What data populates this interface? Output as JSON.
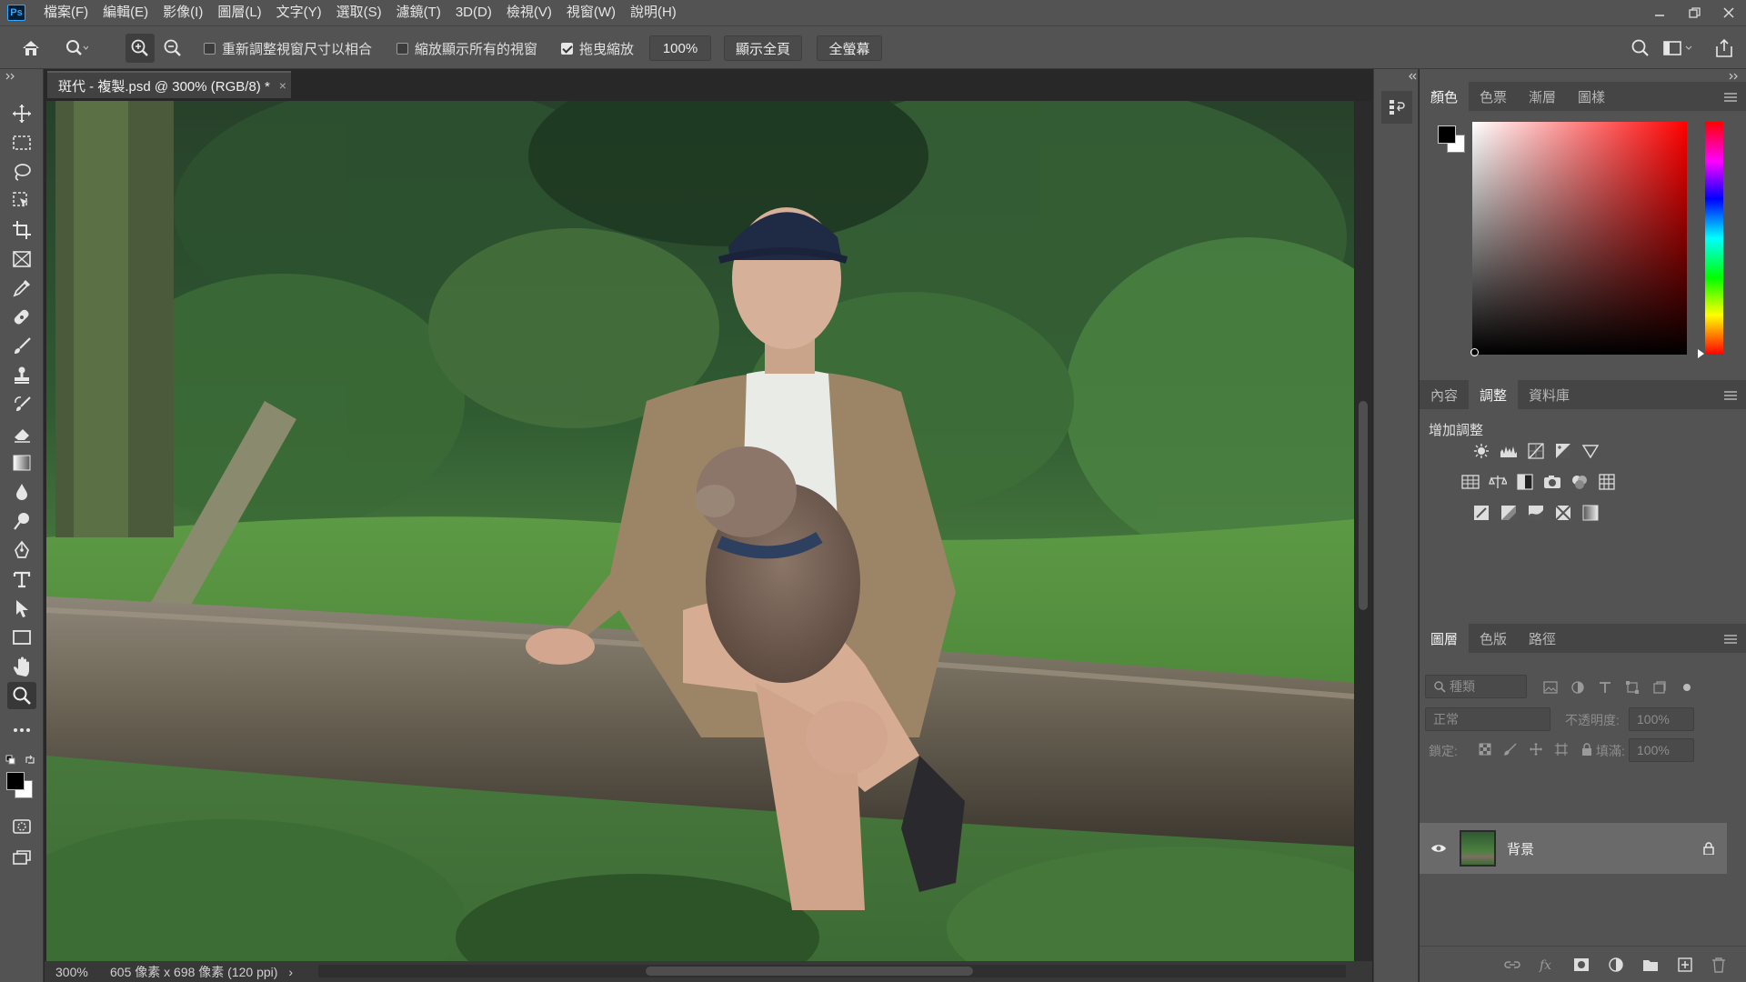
{
  "menubar": {
    "logo": "Ps",
    "items": [
      "檔案(F)",
      "編輯(E)",
      "影像(I)",
      "圖層(L)",
      "文字(Y)",
      "選取(S)",
      "濾鏡(T)",
      "3D(D)",
      "檢視(V)",
      "視窗(W)",
      "說明(H)"
    ]
  },
  "options": {
    "resize_windows_label": "重新調整視窗尺寸以相合",
    "zoom_all_windows_label": "縮放顯示所有的視窗",
    "scrubby_zoom_label": "拖曳縮放",
    "zoom_value": "100%",
    "fit_screen_label": "顯示全頁",
    "fill_screen_label": "全螢幕"
  },
  "document": {
    "tab_title": "斑代 - 複製.psd @ 300% (RGB/8) *",
    "tab_close": "×",
    "zoom": "300%",
    "info": "605 像素 x 698 像素 (120 ppi)",
    "status_arrow": "›"
  },
  "panels": {
    "color_tabs": [
      "顏色",
      "色票",
      "漸層",
      "圖樣"
    ],
    "props_tabs": [
      "內容",
      "調整",
      "資料庫"
    ],
    "adjust_heading": "增加調整",
    "layers_tabs": [
      "圖層",
      "色版",
      "路徑"
    ],
    "kind_placeholder": "種類",
    "blend_mode": "正常",
    "opacity_label": "不透明度:",
    "opacity_value": "100%",
    "lock_label": "鎖定:",
    "fill_label": "填滿:",
    "fill_value": "100%"
  },
  "layers": [
    {
      "name": "背景",
      "visible": true,
      "locked": true
    }
  ],
  "colors": {
    "foreground": "#000000",
    "background": "#ffffff",
    "accent": "#31a8ff"
  }
}
